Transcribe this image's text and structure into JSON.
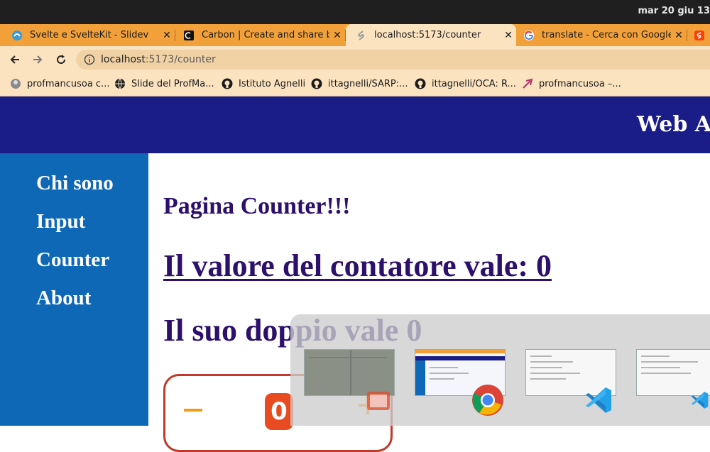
{
  "os": {
    "clock": "mar 20 giu  13"
  },
  "tabs": [
    {
      "title": "Svelte e SvelteKit - Slidev",
      "icon": "slidev-icon"
    },
    {
      "title": "Carbon | Create and share beautiful",
      "icon": "carbon-icon"
    },
    {
      "title": "localhost:5173/counter",
      "icon": "svelte-icon"
    },
    {
      "title": "translate - Cerca con Google",
      "icon": "google-icon"
    }
  ],
  "toolbar": {
    "url_host": "localhost",
    "url_path": ":5173/counter"
  },
  "bookmarks": [
    {
      "label": "profmancusoa c...",
      "icon": "avatar-icon"
    },
    {
      "label": "Slide del ProfMa...",
      "icon": "globe-icon"
    },
    {
      "label": "Istituto Agnelli",
      "icon": "github-icon"
    },
    {
      "label": "ittagnelli/SARP:...",
      "icon": "github-icon"
    },
    {
      "label": "ittagnelli/OCA: R...",
      "icon": "github-icon"
    },
    {
      "label": "profmancusoa –...",
      "icon": "feather-icon"
    }
  ],
  "page": {
    "header_title": "Web Ap",
    "nav": [
      "Chi sono",
      "Input",
      "Counter",
      "About"
    ],
    "title": "Pagina Counter!!!",
    "value_text": "Il valore del contatore vale: 0",
    "double_text": "Il suo doppio vale 0",
    "counter": {
      "value": "0"
    }
  },
  "colors": {
    "tab_strip": "#f2a13a",
    "toolbar": "#fbe3c0",
    "header": "#1a1c88",
    "sidebar": "#0f68b6",
    "text": "#2c106b",
    "counter_border": "#c0392b",
    "counter_accent": "#f39c12"
  }
}
